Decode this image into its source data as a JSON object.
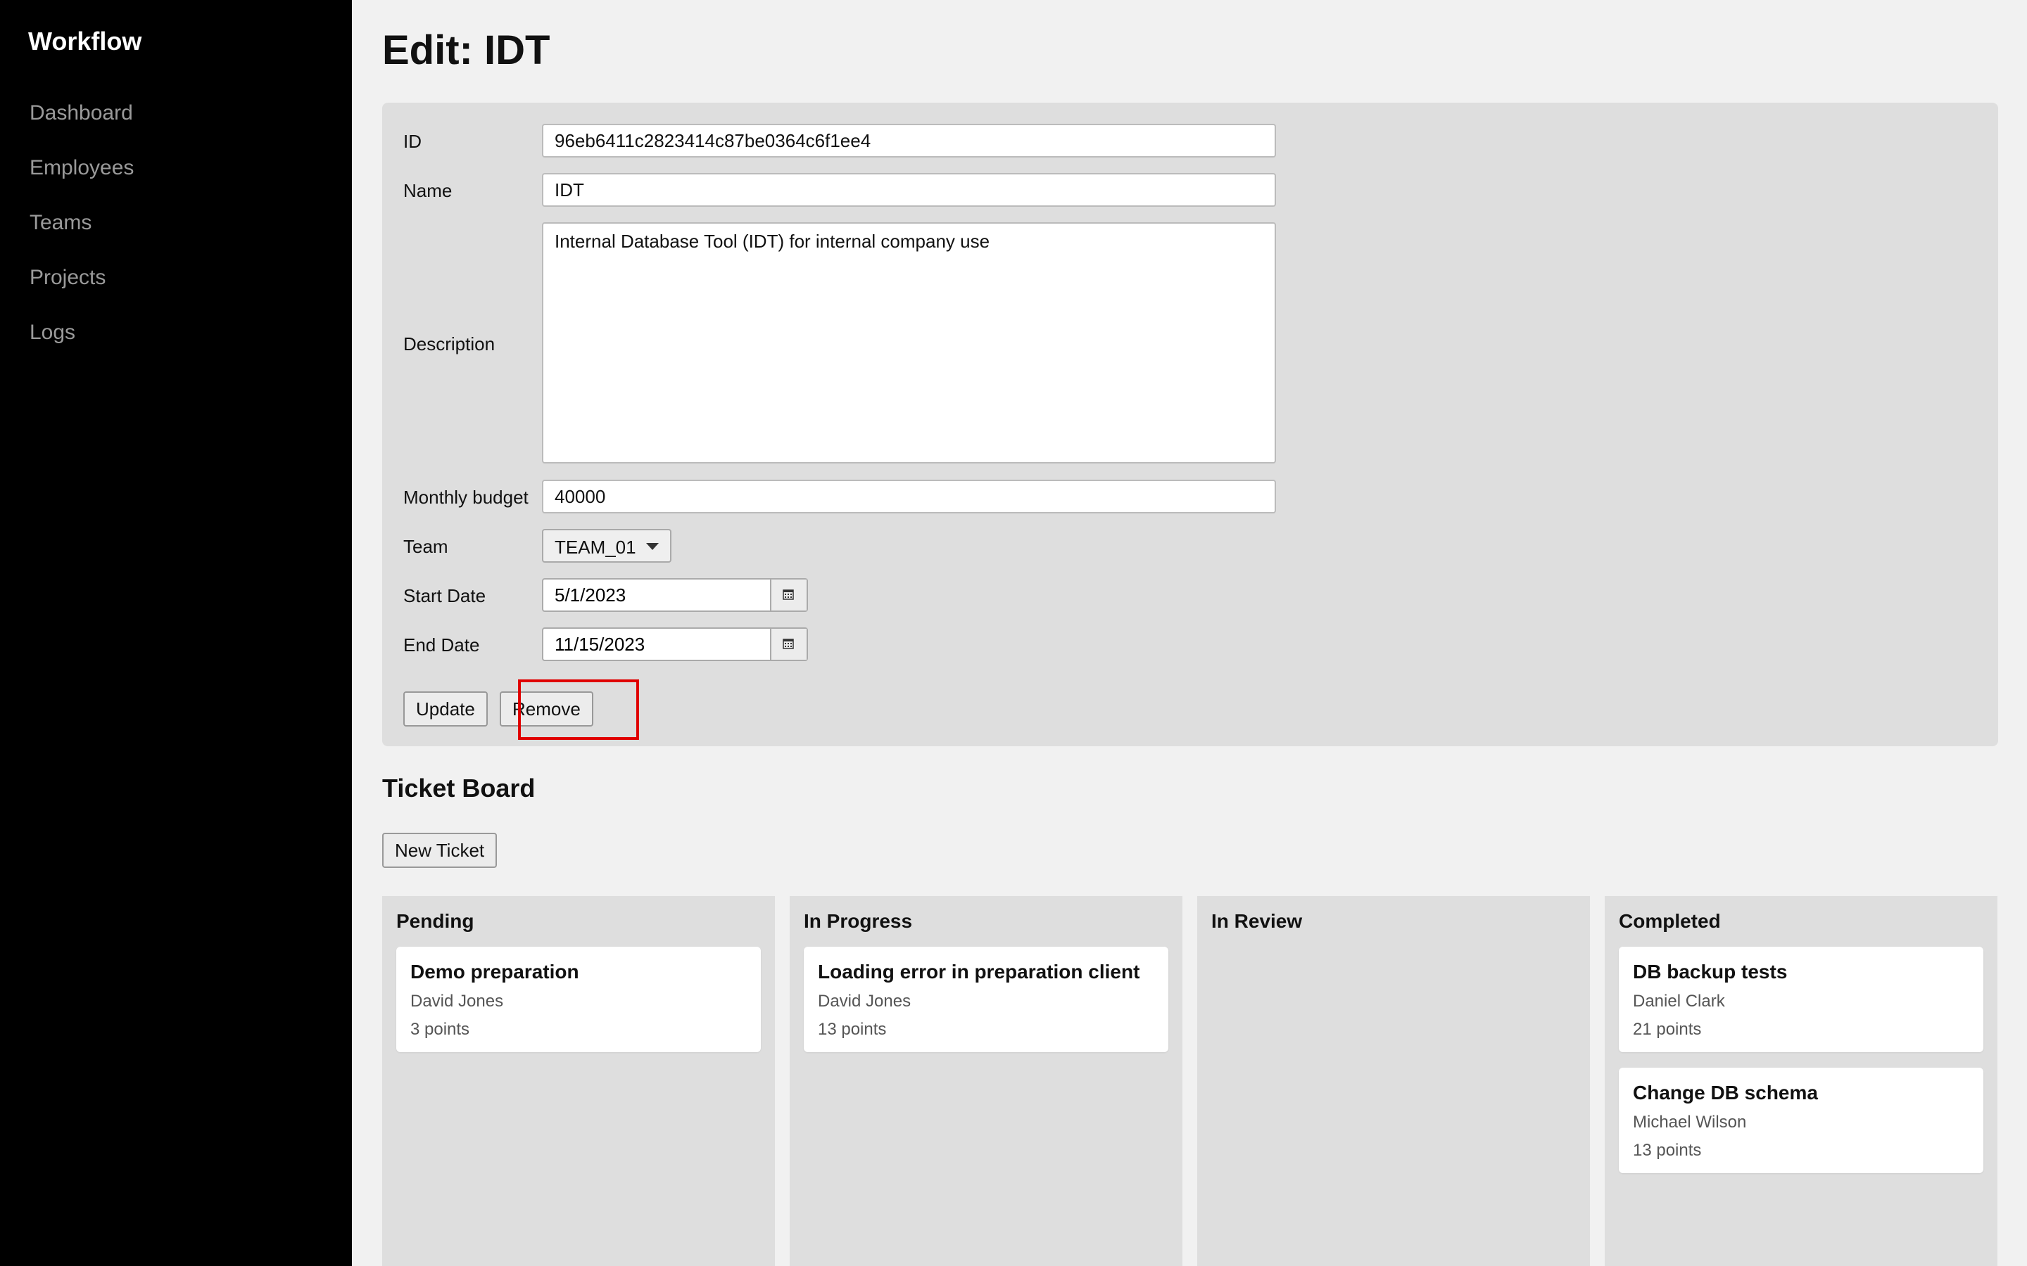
{
  "sidebar": {
    "brand": "Workflow",
    "items": [
      {
        "label": "Dashboard"
      },
      {
        "label": "Employees"
      },
      {
        "label": "Teams"
      },
      {
        "label": "Projects"
      },
      {
        "label": "Logs"
      }
    ]
  },
  "page": {
    "title": "Edit: IDT"
  },
  "form": {
    "id_label": "ID",
    "id_value": "96eb6411c2823414c87be0364c6f1ee4",
    "name_label": "Name",
    "name_value": "IDT",
    "description_label": "Description",
    "description_value": "Internal Database Tool (IDT) for internal company use",
    "budget_label": "Monthly budget",
    "budget_value": "40000",
    "team_label": "Team",
    "team_value": "TEAM_01",
    "start_label": "Start Date",
    "start_value": "5/1/2023",
    "end_label": "End Date",
    "end_value": "11/15/2023",
    "update_label": "Update",
    "remove_label": "Remove"
  },
  "board": {
    "title": "Ticket Board",
    "new_ticket_label": "New Ticket",
    "columns": [
      {
        "title": "Pending",
        "cards": [
          {
            "title": "Demo preparation",
            "assignee": "David Jones",
            "points": "3 points"
          }
        ]
      },
      {
        "title": "In Progress",
        "cards": [
          {
            "title": "Loading error in preparation client",
            "assignee": "David Jones",
            "points": "13 points"
          }
        ]
      },
      {
        "title": "In Review",
        "cards": []
      },
      {
        "title": "Completed",
        "cards": [
          {
            "title": "DB backup tests",
            "assignee": "Daniel Clark",
            "points": "21 points"
          },
          {
            "title": "Change DB schema",
            "assignee": "Michael Wilson",
            "points": "13 points"
          }
        ]
      }
    ]
  },
  "colors": {
    "sidebar_bg": "#000000",
    "page_bg": "#f1f1f1",
    "panel_bg": "#dedede",
    "highlight": "#e00000"
  },
  "icons": {
    "calendar": "calendar-icon",
    "dropdown": "chevron-down-icon"
  }
}
